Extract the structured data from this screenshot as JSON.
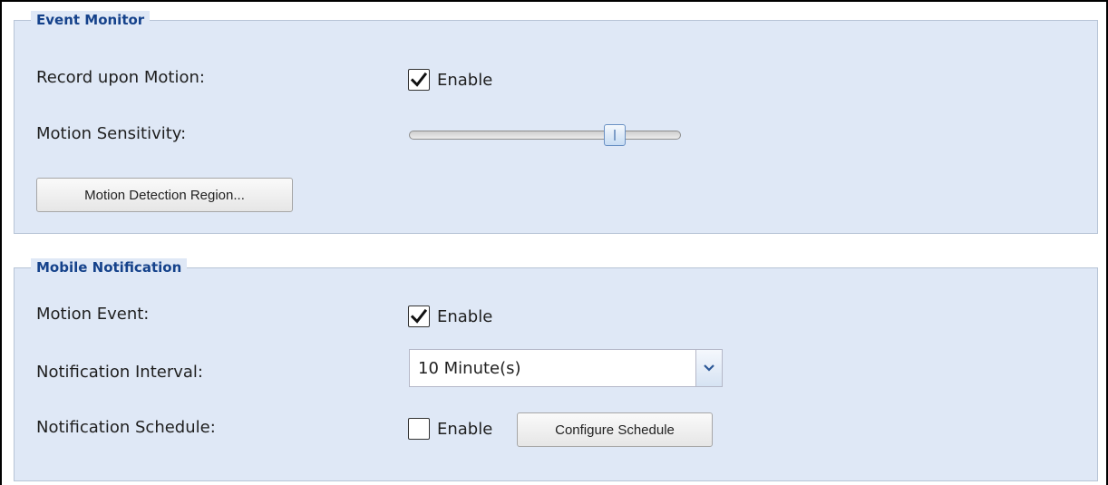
{
  "event_monitor": {
    "title": "Event Monitor",
    "record_label": "Record upon Motion:",
    "record_enable": {
      "label": "Enable",
      "checked": true
    },
    "sensitivity_label": "Motion Sensitivity:",
    "sensitivity_value_fraction": 0.76,
    "region_button": "Motion Detection Region..."
  },
  "mobile_notification": {
    "title": "Mobile Notification",
    "motion_event_label": "Motion Event:",
    "motion_event_enable": {
      "label": "Enable",
      "checked": true
    },
    "interval_label": "Notification Interval:",
    "interval_value": "10 Minute(s)",
    "schedule_label": "Notification Schedule:",
    "schedule_enable": {
      "label": "Enable",
      "checked": false
    },
    "configure_button": "Configure Schedule"
  },
  "icons": {
    "check": "checkmark-icon",
    "dropdown": "chevron-down-icon"
  },
  "colors": {
    "panel_background": "#dfe8f6",
    "legend_text": "#15428b",
    "border": "#b7c4d6"
  }
}
